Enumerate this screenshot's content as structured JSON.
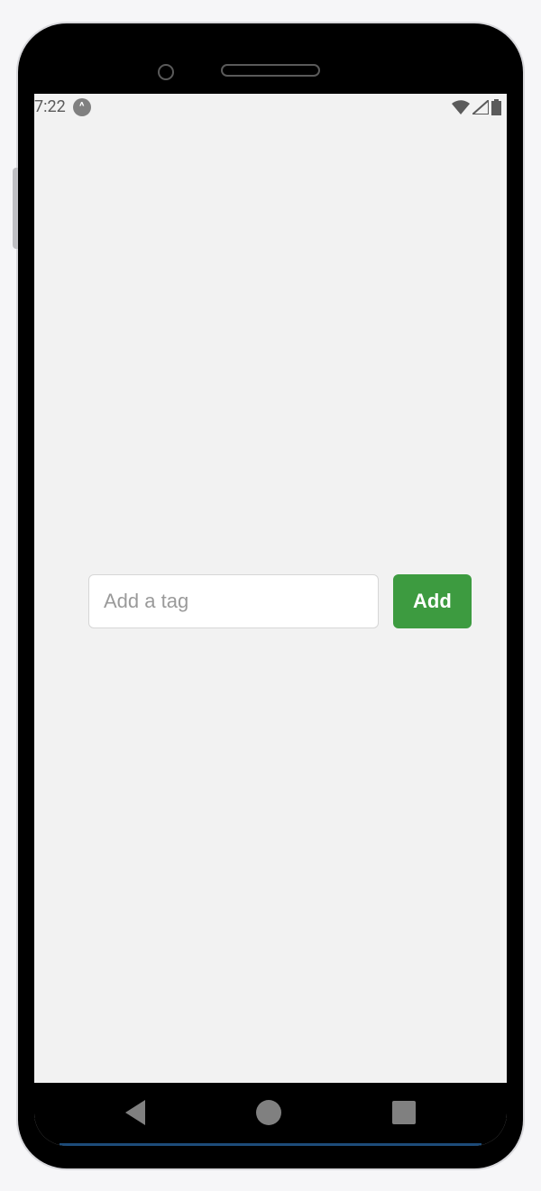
{
  "status_bar": {
    "time": "7:22",
    "notification_icon": "caret-up-icon",
    "right_icons": [
      "wifi-icon",
      "signal-icon",
      "battery-icon"
    ]
  },
  "form": {
    "tag_input_value": "",
    "tag_input_placeholder": "Add a tag",
    "add_button_label": "Add"
  },
  "colors": {
    "primary_green": "#3d9b40",
    "screen_bg": "#f2f2f2",
    "input_border": "#d6d6d6"
  },
  "nav": {
    "buttons": [
      "back",
      "home",
      "recent"
    ]
  }
}
